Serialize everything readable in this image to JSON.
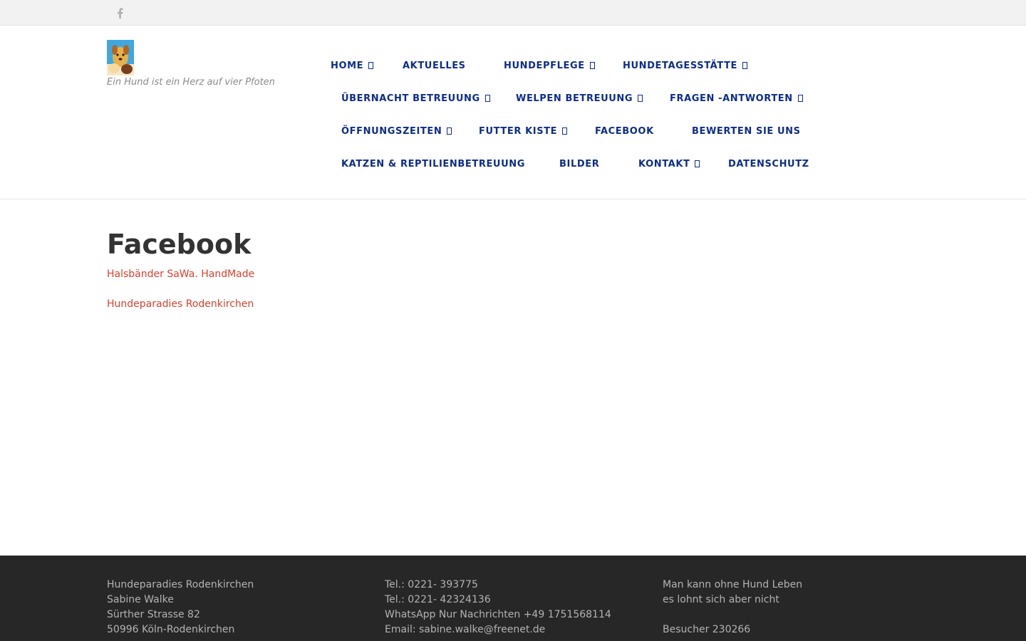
{
  "topbar": {
    "social_icon": "facebook-icon"
  },
  "header": {
    "tagline": "Ein Hund ist ein Herz auf vier Pfoten",
    "logo_colors": {
      "sky": "#3fa7e0",
      "dog": "#e8b04a",
      "dark": "#7a3e1d"
    }
  },
  "nav": {
    "color": "#0d2d8a",
    "items": [
      {
        "label": "HOME",
        "dropdown": true
      },
      {
        "label": "AKTUELLES",
        "dropdown": false
      },
      {
        "label": "HUNDEPFLEGE",
        "dropdown": true
      },
      {
        "label": "HUNDETAGESSTÄTTE",
        "dropdown": true
      },
      {
        "label": "ÜBERNACHT BETREUUNG",
        "dropdown": true
      },
      {
        "label": "WELPEN BETREUUNG",
        "dropdown": true
      },
      {
        "label": "FRAGEN -ANTWORTEN",
        "dropdown": true
      },
      {
        "label": "ÖFFNUNGSZEITEN",
        "dropdown": true
      },
      {
        "label": "FUTTER KISTE",
        "dropdown": true
      },
      {
        "label": "FACEBOOK",
        "dropdown": false
      },
      {
        "label": "BEWERTEN SIE UNS",
        "dropdown": false
      },
      {
        "label": "KATZEN & REPTILIENBETREUUNG",
        "dropdown": false
      },
      {
        "label": "BILDER",
        "dropdown": false
      },
      {
        "label": "KONTAKT",
        "dropdown": true
      },
      {
        "label": "DATENSCHUTZ",
        "dropdown": false
      }
    ]
  },
  "main": {
    "title": "Facebook",
    "link_color": "#d9412f",
    "links": [
      "Halsbänder SaWa. HandMade",
      "Hundeparadies Rodenkirchen"
    ]
  },
  "footer": {
    "col1": [
      "Hundeparadies Rodenkirchen",
      "Sabine Walke",
      "Sürther Strasse 82",
      "50996 Köln-Rodenkirchen"
    ],
    "col2": [
      "Tel.: 0221- 393775",
      "Tel.: 0221- 42324136",
      "WhatsApp Nur Nachrichten +49 1751568114",
      "Email: sabine.walke@freenet.de"
    ],
    "col3": [
      "Man kann ohne Hund Leben",
      "es lohnt sich aber nicht",
      "",
      "Besucher 230266"
    ]
  }
}
